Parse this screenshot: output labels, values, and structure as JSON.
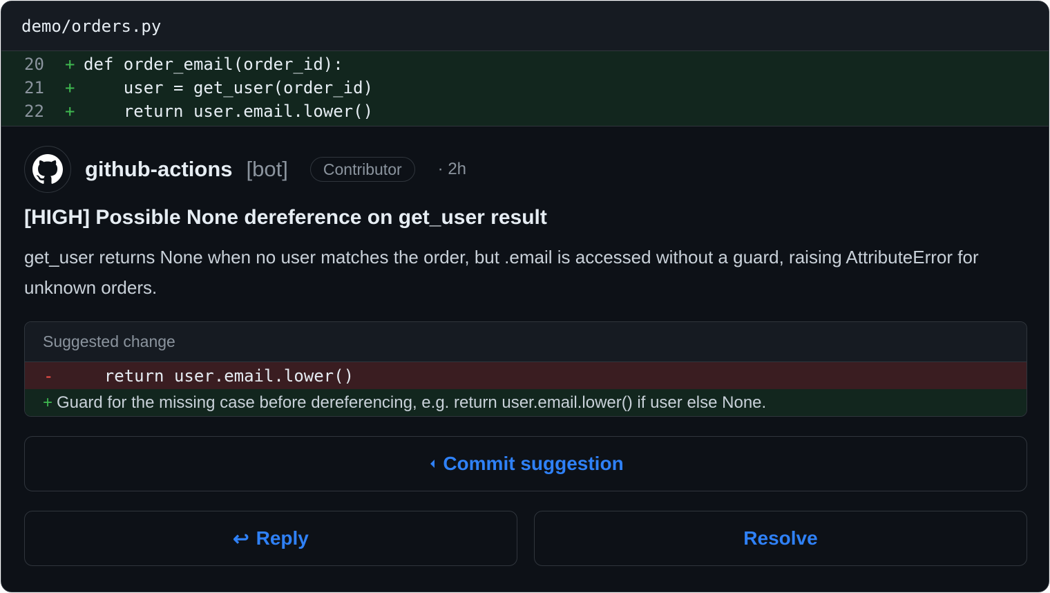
{
  "file": {
    "path": "demo/orders.py",
    "lines": [
      {
        "number": "20",
        "sign": "+",
        "code": "def order_email(order_id):"
      },
      {
        "number": "21",
        "sign": "+",
        "code": "    user = get_user(order_id)"
      },
      {
        "number": "22",
        "sign": "+",
        "code": "    return user.email.lower()"
      }
    ]
  },
  "comment": {
    "author": "github-actions",
    "author_tag": "[bot]",
    "role": "Contributor",
    "time": "· 2h",
    "avatar_icon": "github-mark-icon",
    "title": "[HIGH] Possible None dereference on get_user result",
    "body": "get_user returns None when no user matches the order, but .email is accessed without a guard, raising AttributeError for unknown orders."
  },
  "suggestion": {
    "header": "Suggested change",
    "removed_sign": "-",
    "removed_code": "    return user.email.lower()",
    "added_sign": "+",
    "added_text": "Guard for the missing case before dereferencing, e.g. return user.email.lower() if user else None."
  },
  "actions": {
    "commit_label": "Commit suggestion",
    "commit_icon": "commit-icon",
    "reply_icon_glyph": "↩",
    "reply_label": "Reply",
    "resolve_label": "Resolve"
  },
  "colors": {
    "background": "#0d1117",
    "added_bg": "#12261e",
    "removed_bg": "#3a1d21",
    "accent": "#2f81f7",
    "added_sign": "#3fb950",
    "removed_sign": "#f85149"
  }
}
